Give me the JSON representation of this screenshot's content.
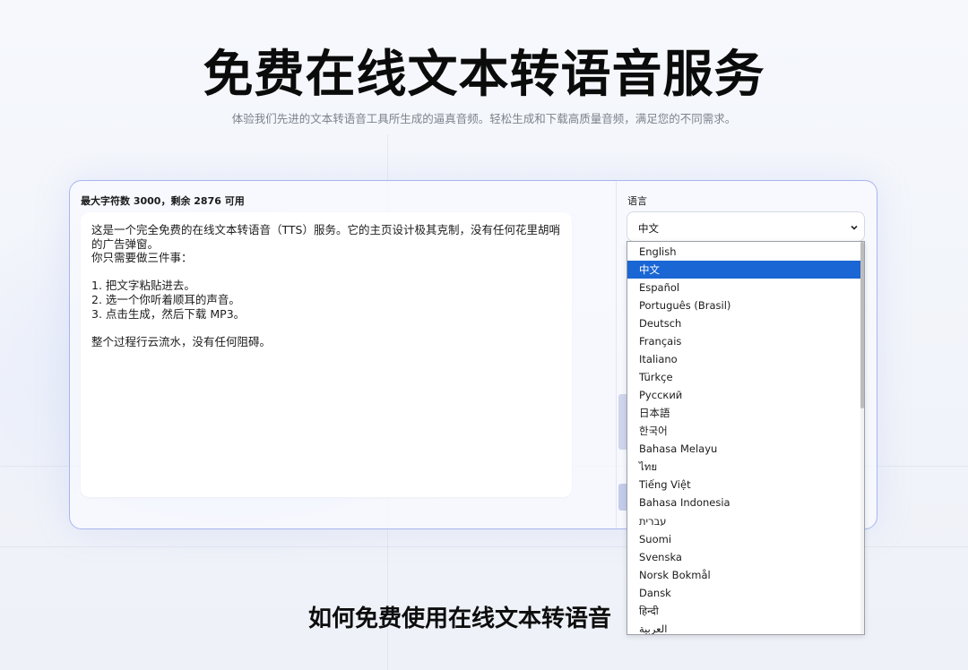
{
  "hero": {
    "title": "免费在线文本转语音服务",
    "subtitle": "体验我们先进的文本转语音工具所生成的逼真音频。轻松生成和下载高质量音频，满足您的不同需求。"
  },
  "editor": {
    "char_count_label": "最大字符数 3000，剩余 2876 可用",
    "text": "这是一个完全免费的在线文本转语音（TTS）服务。它的主页设计极其克制，没有任何花里胡哨的广告弹窗。\n你只需要做三件事：\n\n1. 把文字粘贴进去。\n2. 选一个你听着顺耳的声音。\n3. 点击生成，然后下载 MP3。\n\n整个过程行云流水，没有任何阻碍。"
  },
  "language": {
    "label": "语言",
    "selected": "中文",
    "options": [
      "English",
      "中文",
      "Español",
      "Português (Brasil)",
      "Deutsch",
      "Français",
      "Italiano",
      "Türkçe",
      "Русский",
      "日本語",
      "한국어",
      "Bahasa Melayu",
      "ไทย",
      "Tiếng Việt",
      "Bahasa Indonesia",
      "עברית",
      "Suomi",
      "Svenska",
      "Norsk Bokmål",
      "Dansk",
      "हिन्दी",
      "العربية"
    ],
    "selected_index": 1
  },
  "how_section": {
    "title": "如何免费使用在线文本转语音"
  },
  "icons": {
    "dropdown": "chevron-down-icon"
  },
  "colors": {
    "accent": "#1a66d4",
    "card_border": "#a9b6ee"
  }
}
